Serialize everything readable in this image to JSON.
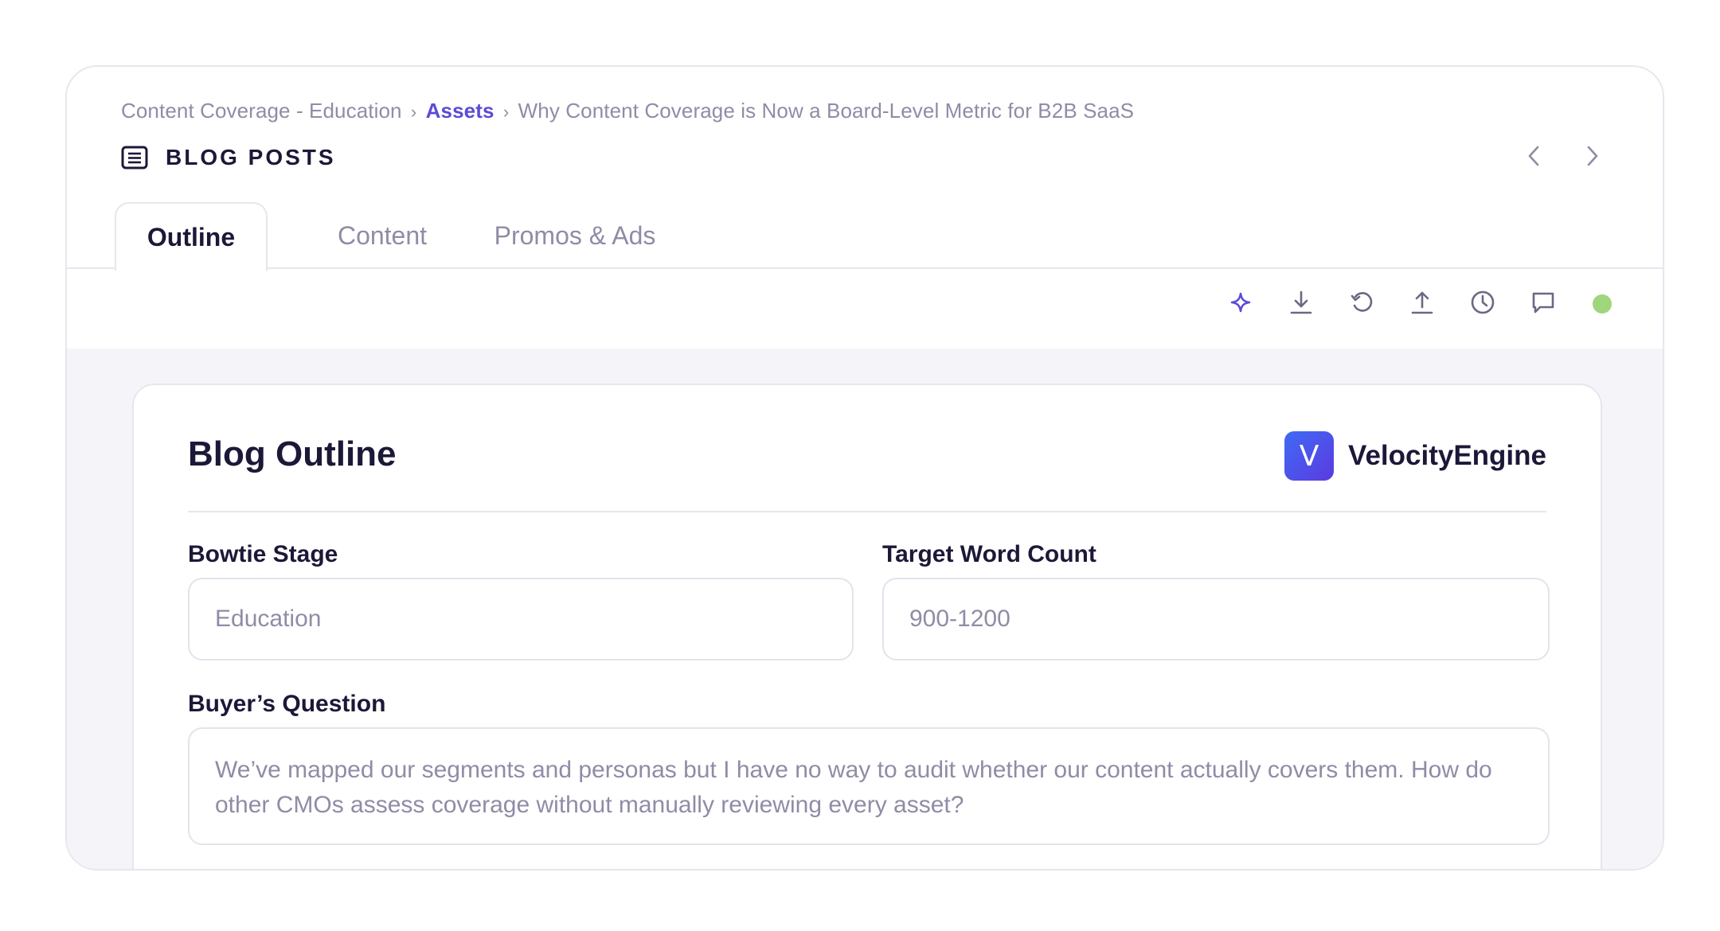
{
  "breadcrumb": {
    "items": [
      "Content Coverage - Education",
      "Assets",
      "Why Content Coverage is Now a Board-Level Metric for B2B SaaS"
    ],
    "separator": "›"
  },
  "section": {
    "title": "BLOG POSTS",
    "icon": "document-lines-icon"
  },
  "pager": {
    "prev_icon": "chevron-left-icon",
    "next_icon": "chevron-right-icon"
  },
  "tabs": [
    {
      "label": "Outline",
      "active": true
    },
    {
      "label": "Content",
      "active": false
    },
    {
      "label": "Promos & Ads",
      "active": false
    }
  ],
  "toolbar": {
    "icons": [
      "sparkle-icon",
      "download-icon",
      "refresh-icon",
      "upload-icon",
      "history-icon",
      "comment-icon"
    ],
    "status_color": "#9fd67d"
  },
  "panel": {
    "title": "Blog Outline",
    "brand": {
      "logo_letter": "V",
      "name": "VelocityEngine"
    },
    "fields": {
      "bowtie_stage": {
        "label": "Bowtie Stage",
        "value": "Education"
      },
      "target_word_count": {
        "label": "Target Word Count",
        "value": "900-1200"
      },
      "buyers_question": {
        "label": "Buyer’s Question",
        "value": "We’ve mapped our segments and personas but I have no way to audit whether our content actually covers them. How do other CMOs assess coverage without manually reviewing every asset?"
      }
    }
  },
  "colors": {
    "accent": "#5b4bd6",
    "text_muted": "#8f8ca6",
    "text_dark": "#1b1838",
    "content_bg": "#f5f5f9",
    "border": "#e6e6ee"
  }
}
